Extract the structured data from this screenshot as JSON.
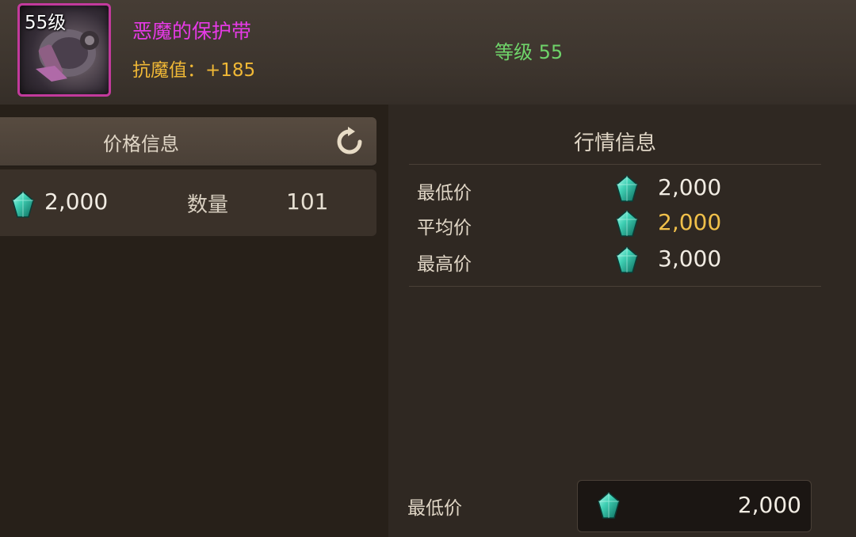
{
  "colors": {
    "item_name": "#e63ae6",
    "item_stat": "#f0b836",
    "level_req": "#6fd46a",
    "avg_price": "#f0c04a",
    "item_border": "#c23a9c",
    "gem": "#3fd0b4"
  },
  "item": {
    "level_badge": "55级",
    "name": "恶魔的保护带",
    "stat": "抗魔值：+185",
    "level_req": "等级 55",
    "icon": "demon-belt-icon"
  },
  "price_info": {
    "title": "价格信息",
    "refresh_icon": "refresh-icon",
    "listing": {
      "currency_icon": "gem-icon",
      "price": "2,000",
      "qty_label": "数量",
      "qty": "101"
    }
  },
  "market_info": {
    "title": "行情信息",
    "rows": [
      {
        "label": "最低价",
        "value": "2,000",
        "currency_icon": "gem-icon"
      },
      {
        "label": "平均价",
        "value": "2,000",
        "currency_icon": "gem-icon"
      },
      {
        "label": "最高价",
        "value": "3,000",
        "currency_icon": "gem-icon"
      }
    ]
  },
  "price_input": {
    "label": "最低价",
    "currency_icon": "gem-icon",
    "value": "2,000"
  }
}
